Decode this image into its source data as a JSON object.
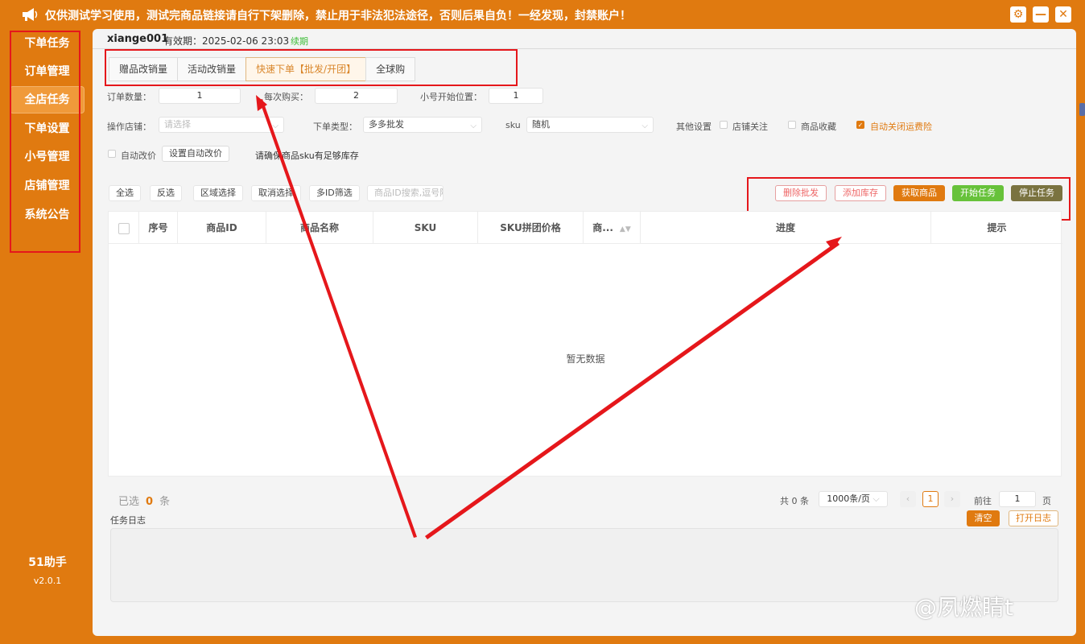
{
  "header": {
    "notice": "仅供测试学习使用，测试完商品链接请自行下架删除，禁止用于非法犯法途径，否则后果自负！一经发现，封禁账户！",
    "icons": [
      "megaphone-icon",
      "gear-icon",
      "minimize-icon",
      "close-icon"
    ],
    "min_glyph": "—",
    "close_glyph": "✕",
    "gear_glyph": "⚙"
  },
  "sidebar": {
    "items": [
      {
        "label": "下单任务"
      },
      {
        "label": "订单管理"
      },
      {
        "label": "全店任务",
        "active": true
      },
      {
        "label": "下单设置"
      },
      {
        "label": "小号管理"
      },
      {
        "label": "店铺管理"
      },
      {
        "label": "系统公告"
      }
    ],
    "brand": "51助手",
    "version": "v2.0.1"
  },
  "account": {
    "user": "xiange001",
    "expire": "有效期：2025-02-06 23:03",
    "renew": "续期"
  },
  "tabs": [
    "赠品改销量",
    "活动改销量",
    "快速下单【批发/开团】",
    "全球购"
  ],
  "form": {
    "order_qty_label": "订单数量：",
    "order_qty": "1",
    "per_buy_label": "每次购买：",
    "per_buy": "2",
    "start_pos_label": "小号开始位置：",
    "start_pos": "1",
    "store_label": "操作店铺：",
    "store_placeholder": "请选择",
    "order_type_label": "下单类型：",
    "order_type": "多多批发",
    "sku_label": "sku",
    "sku_value": "随机",
    "other_label": "其他设置",
    "opt_follow": "店铺关注",
    "opt_fav": "商品收藏",
    "opt_auto_close": "自动关闭运费险",
    "auto_price_label": "自动改价",
    "set_auto_price": "设置自动改价",
    "tip": "请确保商品sku有足够库存"
  },
  "select_buttons": [
    "全选",
    "反选",
    "区域选择",
    "取消选择",
    "多ID筛选"
  ],
  "search_placeholder": "商品ID搜索,逗号隔",
  "actions": {
    "delete_batch": "删除批发",
    "add_stock": "添加库存",
    "fetch_goods": "获取商品",
    "start_task": "开始任务",
    "stop_task": "停止任务"
  },
  "table": {
    "columns": [
      "序号",
      "商品ID",
      "商品名称",
      "SKU",
      "SKU拼团价格",
      "商...",
      "进度",
      "提示"
    ],
    "empty_text": "暂无数据"
  },
  "footer": {
    "selected_prefix": "已选",
    "selected_count": "0",
    "selected_suffix": "条",
    "total": "共 0 条",
    "page_size": "1000条/页",
    "current_page": "1",
    "goto_label": "前往",
    "goto_value": "1",
    "page_suffix": "页",
    "prev": "‹",
    "next": "›"
  },
  "log": {
    "label": "任务日志",
    "clear": "清空",
    "open": "打开日志"
  },
  "watermark": "@夙燃睛t"
}
